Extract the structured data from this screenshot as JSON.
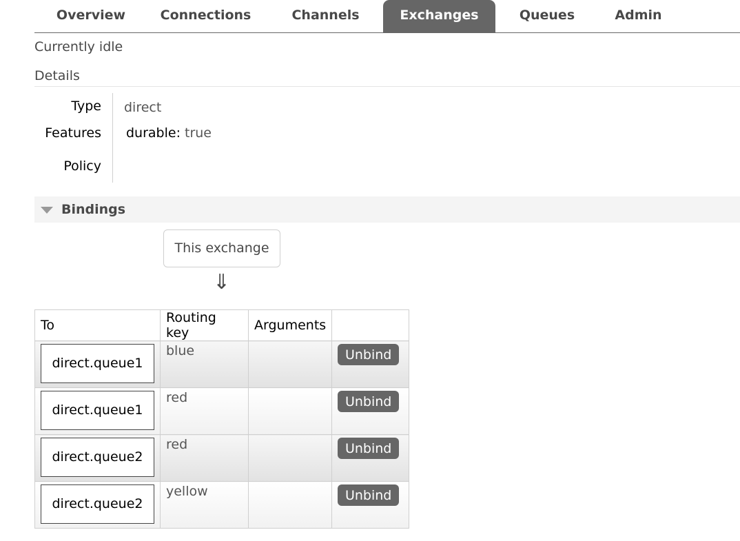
{
  "nav": {
    "tabs": [
      {
        "label": "Overview"
      },
      {
        "label": "Connections"
      },
      {
        "label": "Channels"
      },
      {
        "label": "Exchanges"
      },
      {
        "label": "Queues"
      },
      {
        "label": "Admin"
      }
    ],
    "active": "Exchanges"
  },
  "status": "Currently idle",
  "details": {
    "title": "Details",
    "type_label": "Type",
    "type_value": "direct",
    "features_label": "Features",
    "features_key": "durable:",
    "features_value": "true",
    "policy_label": "Policy"
  },
  "bindings": {
    "title": "Bindings",
    "this_exchange": "This exchange",
    "arrow": "⇓",
    "headers": [
      "To",
      "Routing key",
      "Arguments",
      ""
    ],
    "rows": [
      {
        "to": "direct.queue1",
        "routing_key": "blue",
        "arguments": "",
        "action": "Unbind"
      },
      {
        "to": "direct.queue1",
        "routing_key": "red",
        "arguments": "",
        "action": "Unbind"
      },
      {
        "to": "direct.queue2",
        "routing_key": "red",
        "arguments": "",
        "action": "Unbind"
      },
      {
        "to": "direct.queue2",
        "routing_key": "yellow",
        "arguments": "",
        "action": "Unbind"
      }
    ]
  },
  "colors": {
    "accent": "#666666",
    "text": "#484848"
  }
}
